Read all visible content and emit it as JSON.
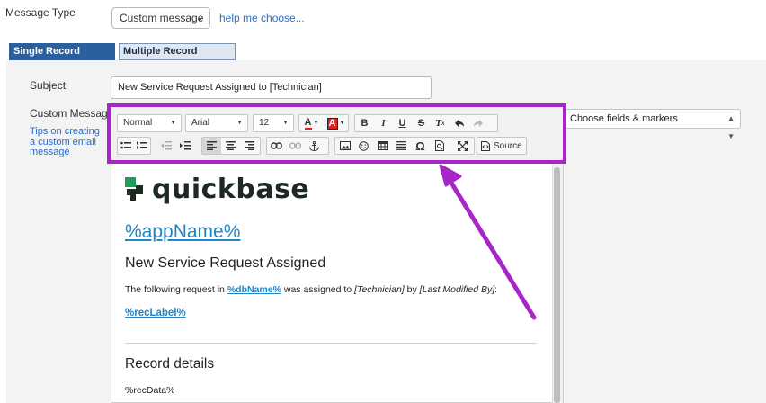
{
  "message_type": {
    "label": "Message Type",
    "selected": "Custom message",
    "help_link": "help me choose..."
  },
  "tabs": [
    {
      "label": "Single Record Version",
      "active": true
    },
    {
      "label": "Multiple Record Version",
      "active": false
    }
  ],
  "subject": {
    "label": "Subject",
    "value": "New Service Request Assigned to [Technician]"
  },
  "custom_message": {
    "label": "Custom Message",
    "tips_link": "Tips on creating a custom email message"
  },
  "fields_dropdown": {
    "selected": "Choose fields & markers"
  },
  "toolbar": {
    "format_value": "Normal",
    "font_value": "Arial",
    "size_value": "12",
    "text_color_label": "A",
    "bg_color_label": "A",
    "bold": "B",
    "italic": "I",
    "underline": "U",
    "strike": "S",
    "clear_format": "T",
    "source_label": "Source"
  },
  "editor": {
    "logo_text": "quickbase",
    "app_name": "%appName%",
    "heading": "New Service Request Assigned",
    "para_prefix": "The following request in ",
    "para_db": "%dbName%",
    "para_mid": " was assigned to ",
    "para_tech": "[Technician]",
    "para_by": " by ",
    "para_modified": "[Last Modified By]",
    "para_end": ":",
    "rec_label": "%recLabel%",
    "section_heading": "Record details",
    "rec_data": "%recData%"
  },
  "colors": {
    "highlight": "#a726c7",
    "tab_active": "#2b5f9e",
    "link": "#2a6fc9",
    "logo_green": "#1e9c5a",
    "logo_dark": "#1c2a22"
  }
}
